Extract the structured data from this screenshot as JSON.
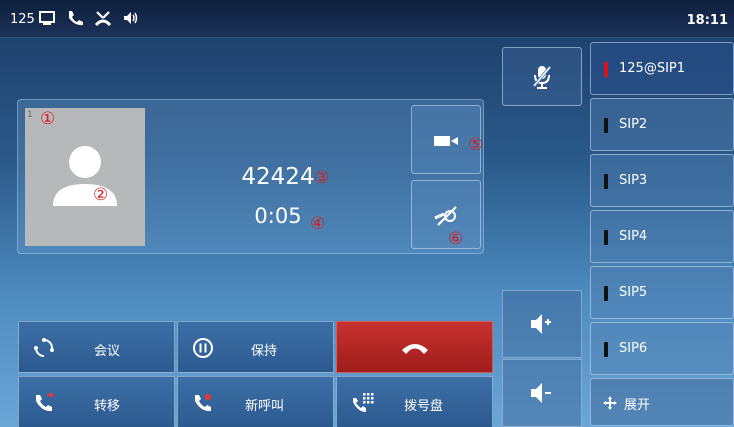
{
  "status_bar": {
    "extension": "125",
    "icons": [
      "phone-handset-off-icon",
      "call-icon",
      "missed-call-icon",
      "speaker-icon"
    ],
    "clock": "18:11"
  },
  "call": {
    "avatar_index": "1",
    "callee_number": "42424",
    "duration": "0:05",
    "markers": [
      "①",
      "②",
      "③",
      "④",
      "⑤",
      "⑥"
    ]
  },
  "side_buttons": {
    "video_icon": "video-camera-icon",
    "hd_icon": "hd-audio-icon"
  },
  "mute_icon": "microphone-mute-icon",
  "volume": {
    "up_icon": "volume-up-icon",
    "down_icon": "volume-down-icon"
  },
  "lines": [
    {
      "label": "125@SIP1",
      "status": "active"
    },
    {
      "label": "SIP2",
      "status": "idle"
    },
    {
      "label": "SIP3",
      "status": "idle"
    },
    {
      "label": "SIP4",
      "status": "idle"
    },
    {
      "label": "SIP5",
      "status": "idle"
    },
    {
      "label": "SIP6",
      "status": "idle"
    }
  ],
  "expand_label": "展开",
  "softkeys": {
    "conference": "会议",
    "hold": "保持",
    "transfer": "转移",
    "new_call": "新呼叫",
    "dialpad": "拨号盘"
  },
  "colors": {
    "end_call": "#b3231f",
    "active_led": "#d8141a",
    "marker": "#d81f1f"
  }
}
